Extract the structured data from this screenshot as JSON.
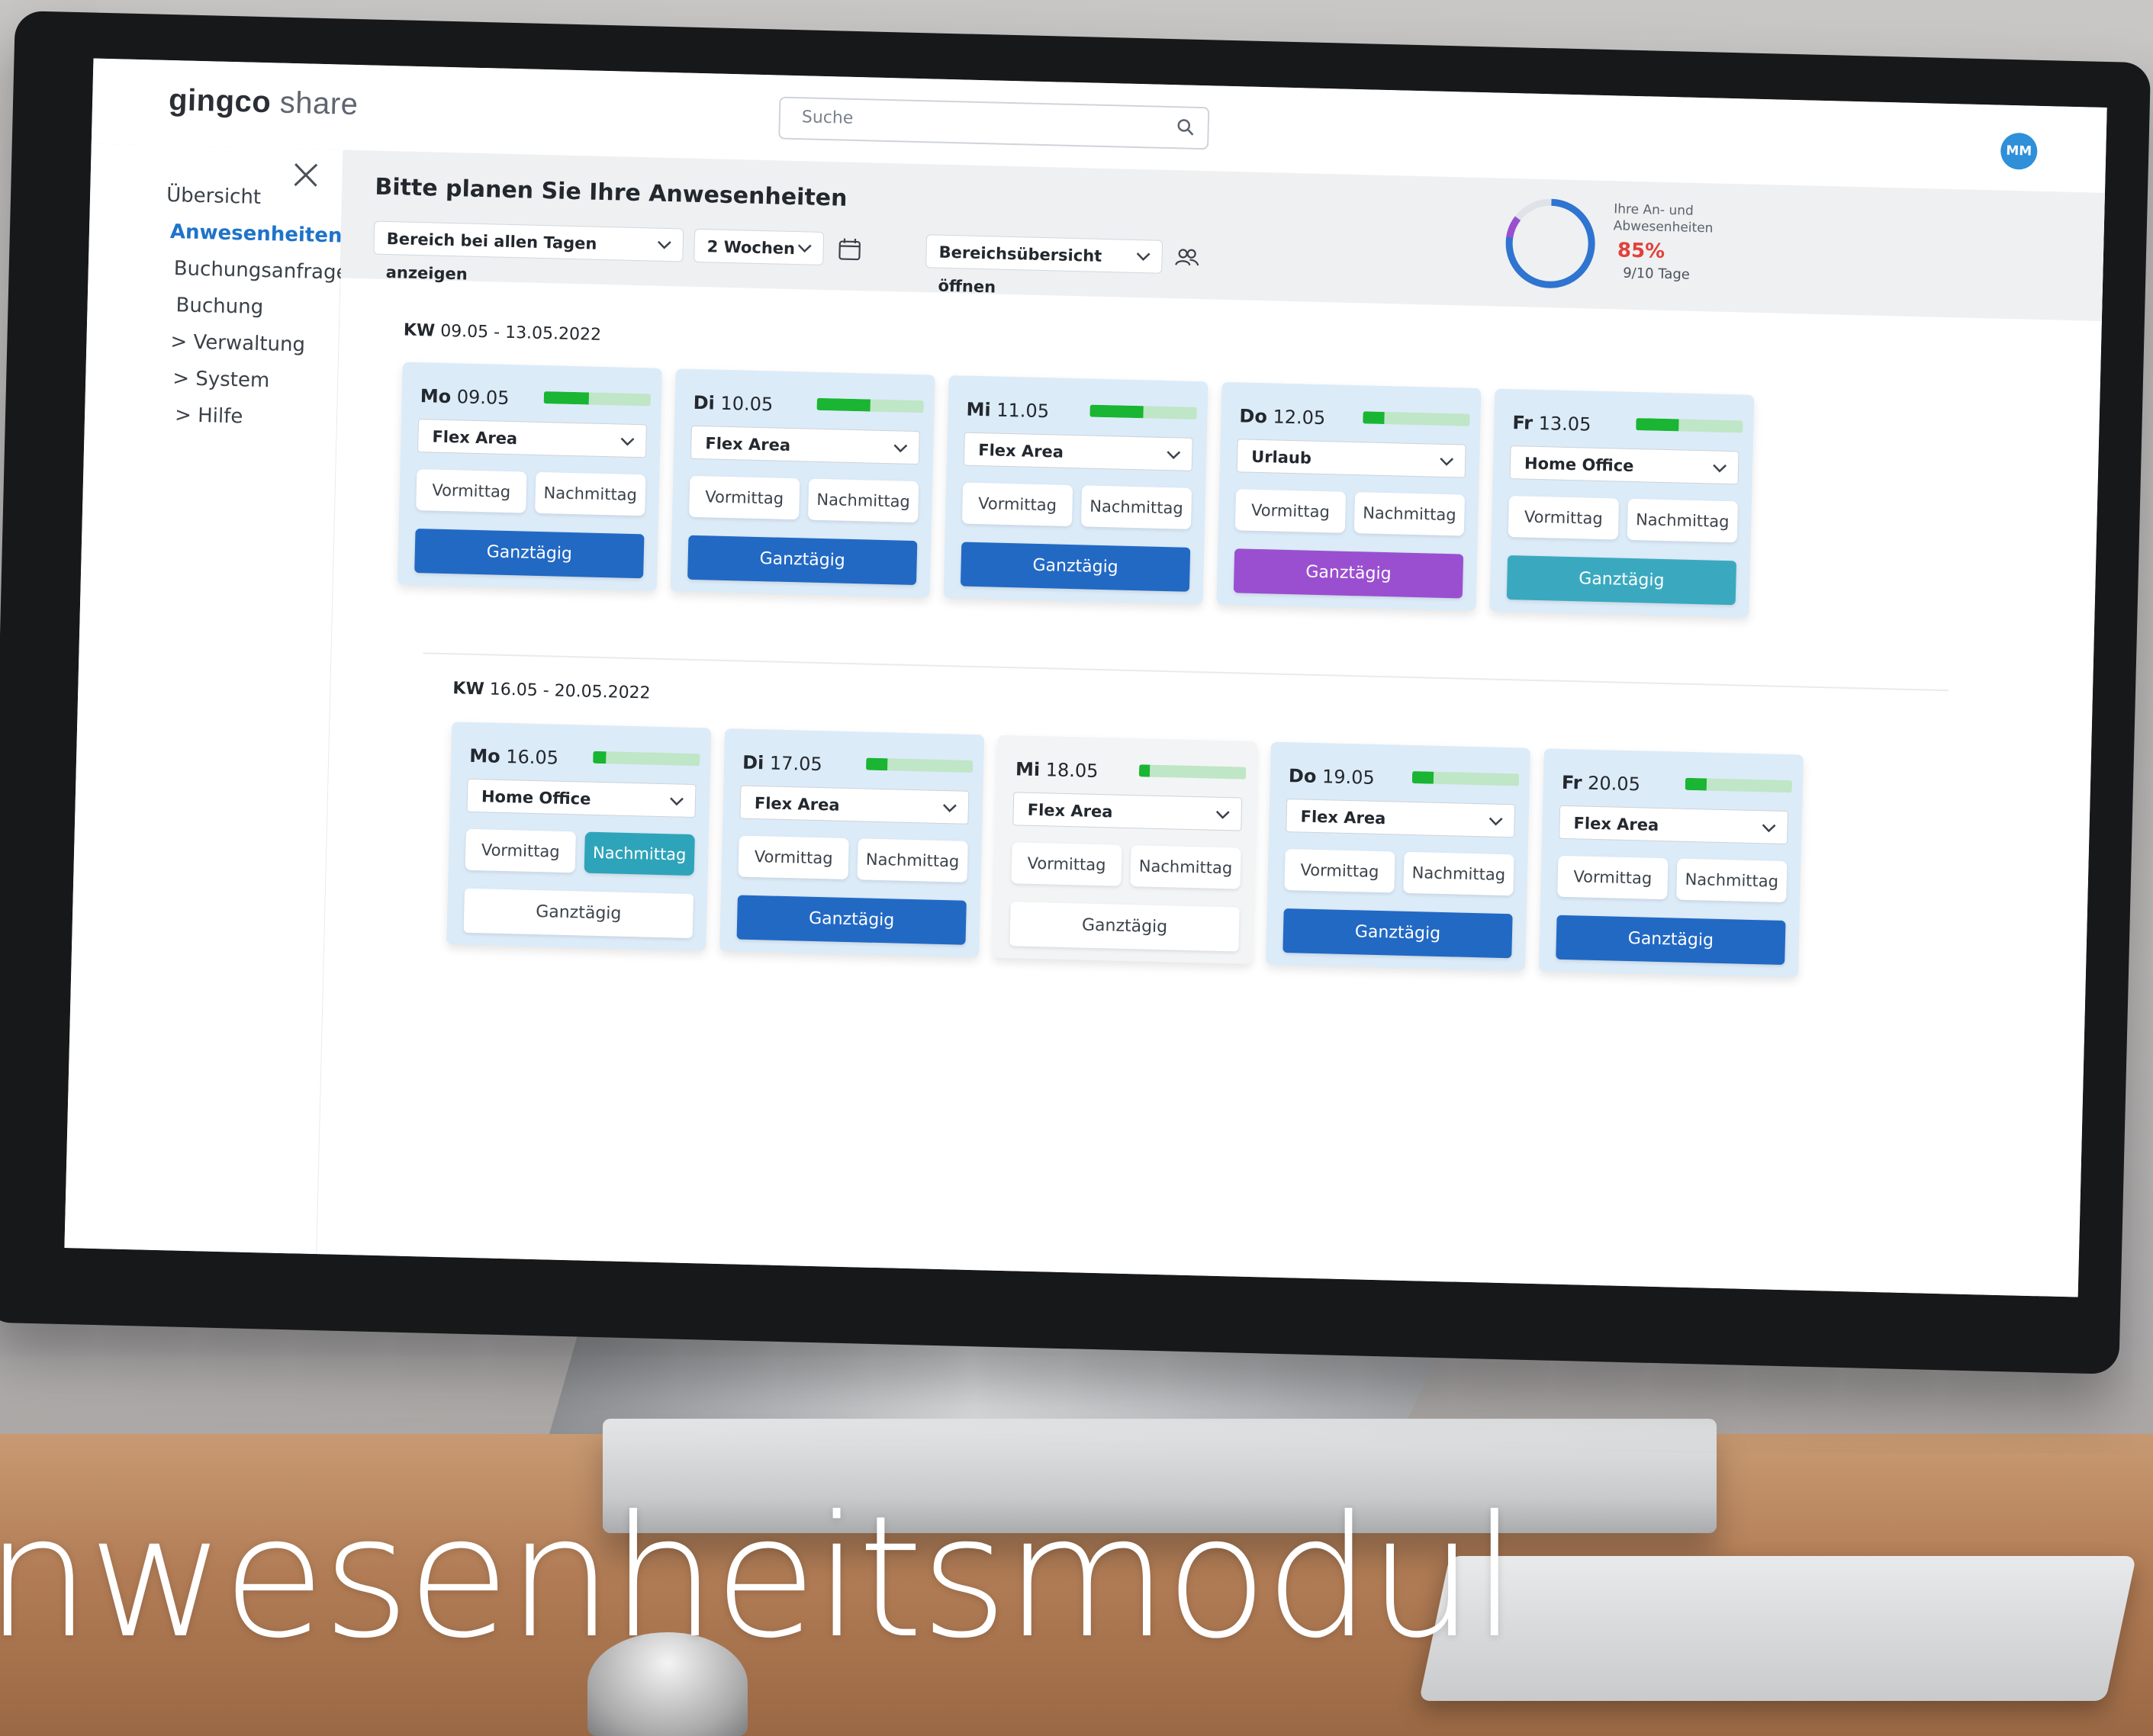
{
  "brand": {
    "name": "gingco",
    "product": "share"
  },
  "search": {
    "placeholder": "Suche"
  },
  "user": {
    "initials": "MM"
  },
  "sidebar": {
    "items": [
      {
        "label": "Übersicht"
      },
      {
        "label": "Anwesenheiten",
        "active": true
      },
      {
        "label": "Buchungsanfrage"
      },
      {
        "label": "Buchung"
      },
      {
        "label": "> Verwaltung"
      },
      {
        "label": "> System"
      },
      {
        "label": "> Hilfe"
      }
    ]
  },
  "header": {
    "title": "Bitte planen Sie Ihre Anwesenheiten",
    "filter_area": "Bereich bei allen Tagen anzeigen",
    "filter_period": "2 Wochen",
    "overview": "Bereichsübersicht öffnen"
  },
  "stats": {
    "label": "Ihre An- und Abwesenheiten",
    "percent": "85%",
    "percent_value": 0.85,
    "days": "9/10 Tage"
  },
  "weeks": [
    {
      "kw": "KW",
      "range": "09.05 - 13.05.2022",
      "days": [
        {
          "weekday": "Mo",
          "date": "09.05",
          "occupancy": 0.42,
          "area": "Flex Area",
          "morning": "Vormittag",
          "afternoon": "Nachmittag",
          "fullday": "Ganztägig"
        },
        {
          "weekday": "Di",
          "date": "10.05",
          "occupancy": 0.5,
          "area": "Flex Area",
          "morning": "Vormittag",
          "afternoon": "Nachmittag",
          "fullday": "Ganztägig"
        },
        {
          "weekday": "Mi",
          "date": "11.05",
          "occupancy": 0.5,
          "area": "Flex Area",
          "morning": "Vormittag",
          "afternoon": "Nachmittag",
          "fullday": "Ganztägig"
        },
        {
          "weekday": "Do",
          "date": "12.05",
          "occupancy": 0.2,
          "area": "Urlaub",
          "morning": "Vormittag",
          "afternoon": "Nachmittag",
          "fullday": "Ganztägig"
        },
        {
          "weekday": "Fr",
          "date": "13.05",
          "occupancy": 0.4,
          "area": "Home Office",
          "morning": "Vormittag",
          "afternoon": "Nachmittag",
          "fullday": "Ganztägig"
        }
      ]
    },
    {
      "kw": "KW",
      "range": "16.05 - 20.05.2022",
      "days": [
        {
          "weekday": "Mo",
          "date": "16.05",
          "occupancy": 0.12,
          "area": "Home Office",
          "morning": "Vormittag",
          "afternoon": "Nachmittag",
          "fullday": "Ganztägig"
        },
        {
          "weekday": "Di",
          "date": "17.05",
          "occupancy": 0.2,
          "area": "Flex Area",
          "morning": "Vormittag",
          "afternoon": "Nachmittag",
          "fullday": "Ganztägig"
        },
        {
          "weekday": "Mi",
          "date": "18.05",
          "occupancy": 0.1,
          "area": "Flex Area",
          "morning": "Vormittag",
          "afternoon": "Nachmittag",
          "fullday": "Ganztägig"
        },
        {
          "weekday": "Do",
          "date": "19.05",
          "occupancy": 0.2,
          "area": "Flex Area",
          "morning": "Vormittag",
          "afternoon": "Nachmittag",
          "fullday": "Ganztägig"
        },
        {
          "weekday": "Fr",
          "date": "20.05",
          "occupancy": 0.2,
          "area": "Flex Area",
          "morning": "Vormittag",
          "afternoon": "Nachmittag",
          "fullday": "Ganztägig"
        }
      ]
    }
  ],
  "colors": {
    "accent_blue": "#2269c4",
    "vacation_purple": "#9a4fd0",
    "homeoffice_teal": "#3aa9bf",
    "occupancy_green": "#19b533",
    "percent_red": "#e2403a"
  },
  "caption": "nwesenheitsmodul"
}
